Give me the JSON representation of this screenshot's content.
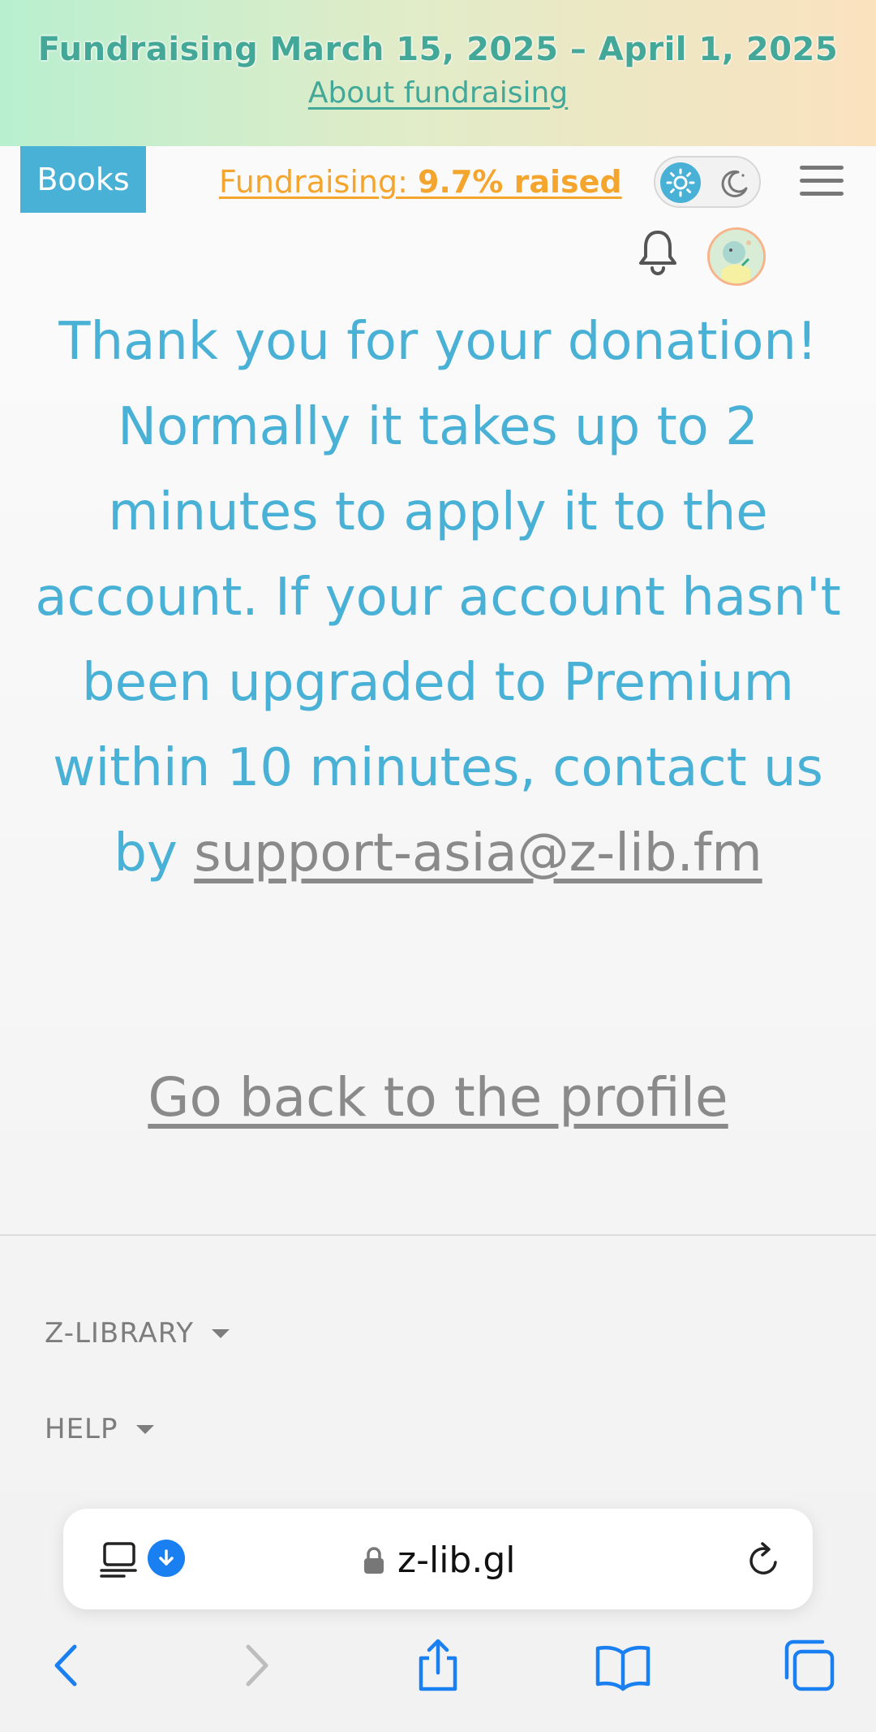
{
  "banner": {
    "title": "Fundraising March 15, 2025 – April 1, 2025",
    "link": "About fundraising"
  },
  "header": {
    "books_tab": "Books",
    "fund_prefix": "Fundraising: ",
    "fund_value": "9.7% raised"
  },
  "message": {
    "text": "Thank you for your donation! Normally it takes up to 2 minutes to apply it to the account. If your account hasn't been upgraded to Premium within 10 minutes, contact us by ",
    "email": "support-asia@z-lib.fm",
    "back_link": "Go back to the profile"
  },
  "footer": {
    "items": [
      "Z-LIBRARY",
      "HELP"
    ]
  },
  "browser": {
    "url": "z-lib.gl"
  },
  "colors": {
    "accent": "#4ab1d6",
    "fundraising": "#f3a52d",
    "banner_text": "#43a898",
    "link_gray": "#8a8a8a",
    "ios_blue": "#1a7ff0"
  },
  "icons": [
    "sun-icon",
    "moon-icon",
    "menu-icon",
    "bell-icon",
    "avatar",
    "reader-icon",
    "download-icon",
    "lock-icon",
    "reload-icon",
    "back-icon",
    "forward-icon",
    "share-icon",
    "bookmarks-icon",
    "tabs-icon"
  ]
}
